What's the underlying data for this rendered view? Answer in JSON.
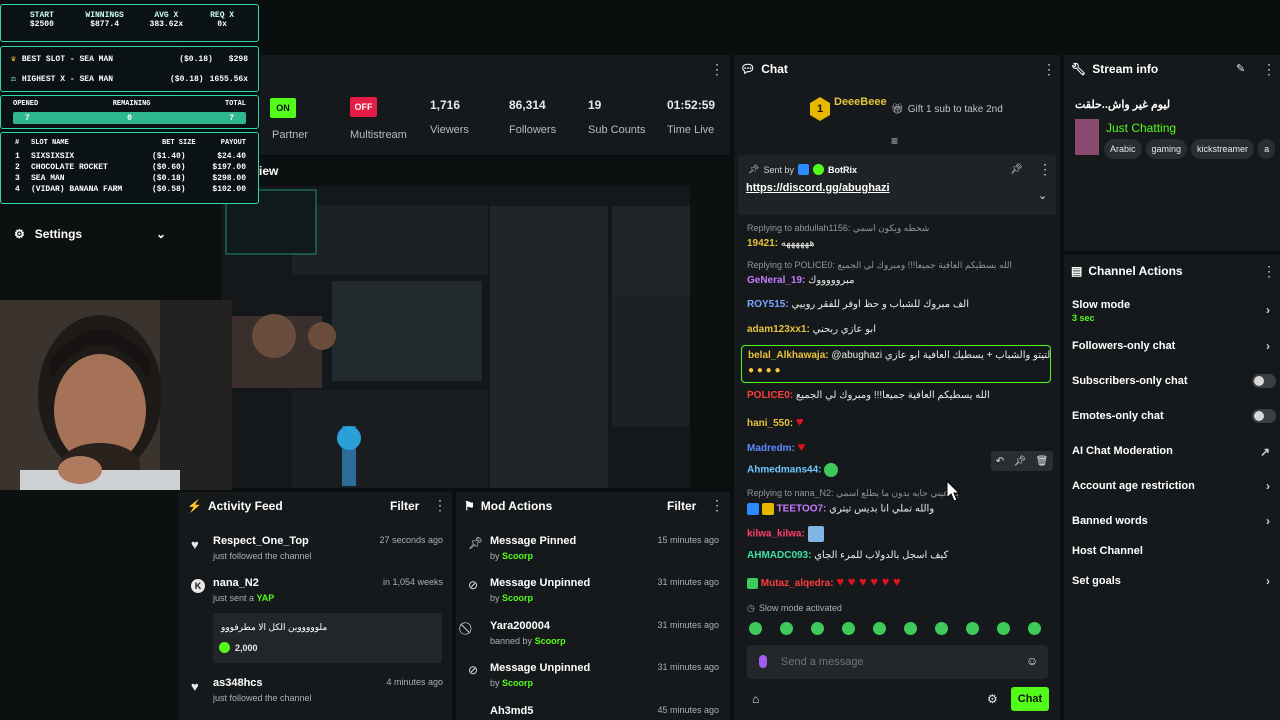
{
  "overlay": {
    "top": [
      {
        "label": "START",
        "value": "$2500"
      },
      {
        "label": "WINNINGS",
        "value": "$877.4"
      },
      {
        "label": "AVG X",
        "value": "383.62x"
      },
      {
        "label": "REQ X",
        "value": "0x"
      }
    ],
    "best_slot": {
      "label": "BEST SLOT",
      "name": "- SEA MAN",
      "bet": "($0.18)",
      "win": "$298"
    },
    "highest_x": {
      "label": "HIGHEST X",
      "name": "- SEA MAN",
      "bet": "($0.18)",
      "win": "1655.56x"
    },
    "counts": {
      "opened_label": "OPENED",
      "remaining_label": "REMAINING",
      "total_label": "TOTAL",
      "opened": "7",
      "remaining": "0",
      "total": "7"
    },
    "table_headers": {
      "num": "#",
      "name": "SLOT NAME",
      "bet": "BET SIZE",
      "payout": "PAYOUT"
    },
    "slots": [
      {
        "n": "1",
        "name": "SIXSIXSIX",
        "bet": "($1.40)",
        "payout": "$24.40"
      },
      {
        "n": "2",
        "name": "CHOCOLATE ROCKET",
        "bet": "($0.60)",
        "payout": "$197.00"
      },
      {
        "n": "3",
        "name": "SEA MAN",
        "bet": "($0.18)",
        "payout": "$298.00"
      },
      {
        "n": "4",
        "name": "(VIDAR) BANANA FARM",
        "bet": "($0.58)",
        "payout": "$102.00"
      }
    ]
  },
  "sidebar": {
    "settings_label": "Settings"
  },
  "stats": {
    "partner_badge": "ON",
    "partner_label": "Partner",
    "multistream_badge": "OFF",
    "multistream_label": "Multistream",
    "viewers_value": "1,716",
    "viewers_label": "Viewers",
    "followers_value": "86,314",
    "followers_label": "Followers",
    "subs_value": "19",
    "subs_label": "Sub Counts",
    "time_value": "01:52:59",
    "time_label": "Time Live"
  },
  "preview": {
    "title": "iew"
  },
  "chat": {
    "title": "Chat",
    "top_gifter_name": "DeeeBeee",
    "top_gifter_rank": "1",
    "gift_text": "Gift 1 sub to take 2nd",
    "pinned_sender_prefix": "Sent by",
    "pinned_sender": "BotRix",
    "pinned_link": "https://discord.gg/abughazi",
    "messages": [
      {
        "reply": "Replying to abdullah1156: شحطه ويكون اسمي",
        "user": "19421:",
        "user_color": "#e6c33c",
        "text": "ههههههه"
      },
      {
        "reply": "Replying to POLICE0: الله يسطيكم العافية جميعا!!! ومبروك لي الجميع",
        "user": "GeNeral_19:",
        "user_color": "#c57bff",
        "text": "مبروووووك"
      },
      {
        "user": "ROY515:",
        "user_color": "#7aa6ff",
        "text": "الف مبروك للشباب و حظ اوفر للفقر روبيي"
      },
      {
        "user": "adam123xx1:",
        "user_color": "#e6c33c",
        "text": "ابو عازي ربحني"
      },
      {
        "user": "belal_Alkhawaja:",
        "user_color": "#e6c33c",
        "text": "@abughazi تاكيو لتيتو والشباب + يسطيك العافية ابو عازي"
      },
      {
        "user": "POLICE0:",
        "user_color": "#ff3d3d",
        "text": "الله يسطيكم العافية جميعا!!! ومبروك لي الجميع"
      },
      {
        "user": "hani_550:",
        "user_color": "#e6c33c",
        "text": ""
      },
      {
        "user": "Madredm:",
        "user_color": "#5b8cff",
        "text": ""
      },
      {
        "user": "Ahmedmans44:",
        "user_color": "#6ec6ff",
        "text": ""
      },
      {
        "reply": "Replying to nana_N2: يلا عيني جايه بدون ما يطلع اسمي",
        "user": "TEETOO7:",
        "user_color": "#c57bff",
        "text": "والله تملي انا بديس تيتري"
      },
      {
        "user": "kilwa_kilwa:",
        "user_color": "#ff3d6e",
        "text": ""
      },
      {
        "user": "AHMADC093:",
        "user_color": "#3ee0a0",
        "text": "كيف اسجل بالدولاب للمرء الجاي"
      },
      {
        "user": "Mutaz_alqedra:",
        "user_color": "#ff3d3d",
        "text": ""
      }
    ],
    "slow_mode_notice": "Slow mode activated",
    "input_placeholder": "Send a message",
    "send_button": "Chat"
  },
  "stream_info": {
    "title": "Stream info",
    "stream_title": "ليوم غير واش..حلقت",
    "category": "Just Chatting",
    "tags": [
      "Arabic",
      "gaming",
      "kickstreamer",
      "a"
    ]
  },
  "channel_actions": {
    "title": "Channel Actions",
    "slow_mode": "Slow mode",
    "slow_mode_value": "3 sec",
    "followers_only": "Followers-only chat",
    "subscribers_only": "Subscribers-only chat",
    "emotes_only": "Emotes-only chat",
    "ai_moderation": "AI Chat Moderation",
    "age_restriction": "Account age restriction",
    "banned_words": "Banned words",
    "host_channel": "Host Channel",
    "set_goals": "Set goals"
  },
  "activity_feed": {
    "title": "Activity Feed",
    "filter": "Filter",
    "items": [
      {
        "name": "Respect_One_Top",
        "sub": "just followed the channel",
        "time": "27 seconds ago"
      },
      {
        "name": "nana_N2",
        "sub_prefix": "just sent a",
        "sub_highlight": "YAP",
        "time": "in 1,054 weeks",
        "quote": "ملوووووين الكل الا مطرفووو",
        "amount": "2,000"
      },
      {
        "name": "as348hcs",
        "sub": "just followed the channel",
        "time": "4 minutes ago"
      }
    ]
  },
  "mod_actions": {
    "title": "Mod Actions",
    "filter": "Filter",
    "items": [
      {
        "action": "Message Pinned",
        "by": "by",
        "mod": "Scoorp",
        "time": "15 minutes ago"
      },
      {
        "action": "Message Unpinned",
        "by": "by",
        "mod": "Scoorp",
        "time": "31 minutes ago"
      },
      {
        "action": "Yara200004",
        "by": "banned by",
        "mod": "Scoorp",
        "time": "31 minutes ago"
      },
      {
        "action": "Message Unpinned",
        "by": "by",
        "mod": "Scoorp",
        "time": "31 minutes ago"
      },
      {
        "action": "Ah3md5",
        "by": "",
        "mod": "",
        "time": "45 minutes ago"
      }
    ]
  },
  "colors": {
    "accent": "#53fc18",
    "panel": "#16191b",
    "bg": "#0b0e0f",
    "overlay_border": "#2fd9a8"
  }
}
